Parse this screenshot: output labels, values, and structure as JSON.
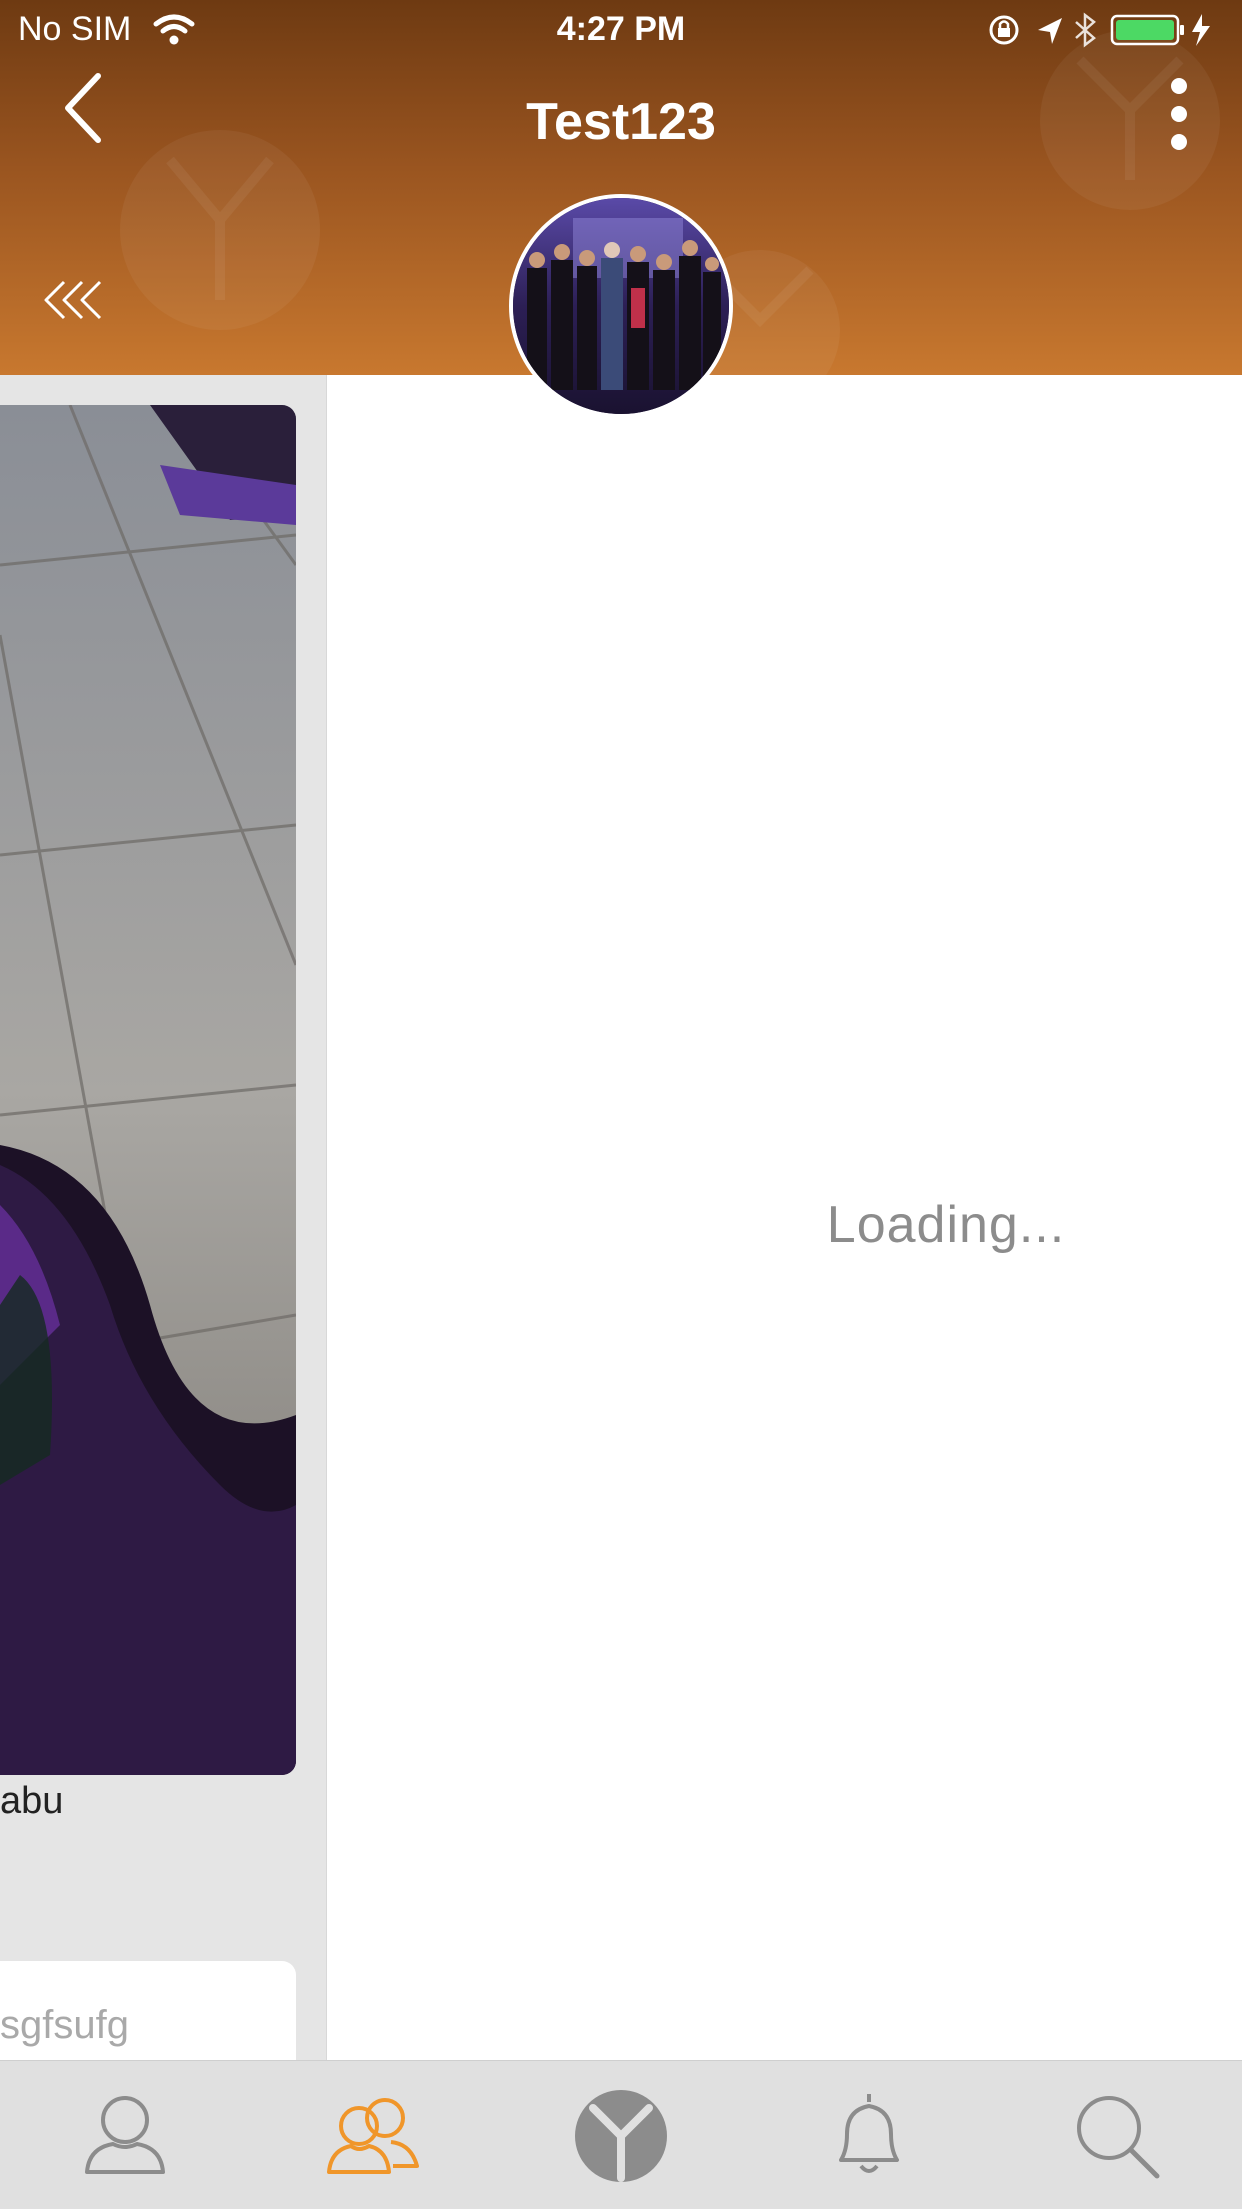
{
  "status_bar": {
    "carrier": "No SIM",
    "time": "4:27 PM",
    "icons": [
      "wifi-icon",
      "rotation-lock-icon",
      "location-icon",
      "bluetooth-icon",
      "battery-icon",
      "charging-icon"
    ]
  },
  "nav": {
    "title": "Test123",
    "back_icon": "chevron-left-icon",
    "more_icon": "more-vertical-icon",
    "collapse_icon": "double-chevron-left-icon"
  },
  "feed": {
    "author": "abu",
    "comment_preview": "sgfsufg"
  },
  "detail": {
    "loading_text": "Loading..."
  },
  "tab_bar": {
    "tabs": [
      {
        "icon": "profile-icon",
        "active": false
      },
      {
        "icon": "groups-icon",
        "active": true
      },
      {
        "icon": "home-logo-icon",
        "active": false
      },
      {
        "icon": "bell-icon",
        "active": false
      },
      {
        "icon": "search-icon",
        "active": false
      }
    ]
  },
  "colors": {
    "header_top": "#6e3a12",
    "header_bottom": "#c8782f",
    "active_tab": "#f0962a",
    "inactive_tab": "#8c8c8c",
    "tab_bar_bg": "#e0e0e0"
  }
}
